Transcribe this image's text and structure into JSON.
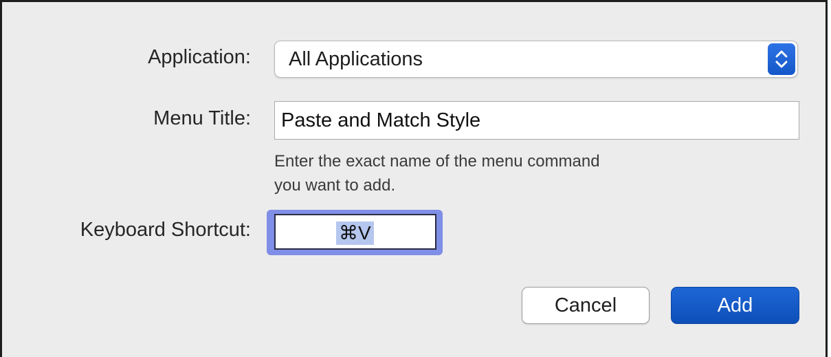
{
  "form": {
    "application_label": "Application:",
    "application_value": "All Applications",
    "menu_title_label": "Menu Title:",
    "menu_title_value": "Paste and Match Style",
    "help_line_1": "Enter the exact name of the menu command",
    "help_line_2": "you want to add.",
    "shortcut_label": "Keyboard Shortcut:",
    "shortcut_value": "⌘V"
  },
  "buttons": {
    "cancel_label": "Cancel",
    "add_label": "Add"
  },
  "icons": {
    "popup_stepper": "chevron-up-down-icon"
  },
  "colors": {
    "accent": "#1457c8",
    "focus_ring": "#7f8ee6",
    "selection": "#b5c7ee",
    "background": "#ececec"
  }
}
